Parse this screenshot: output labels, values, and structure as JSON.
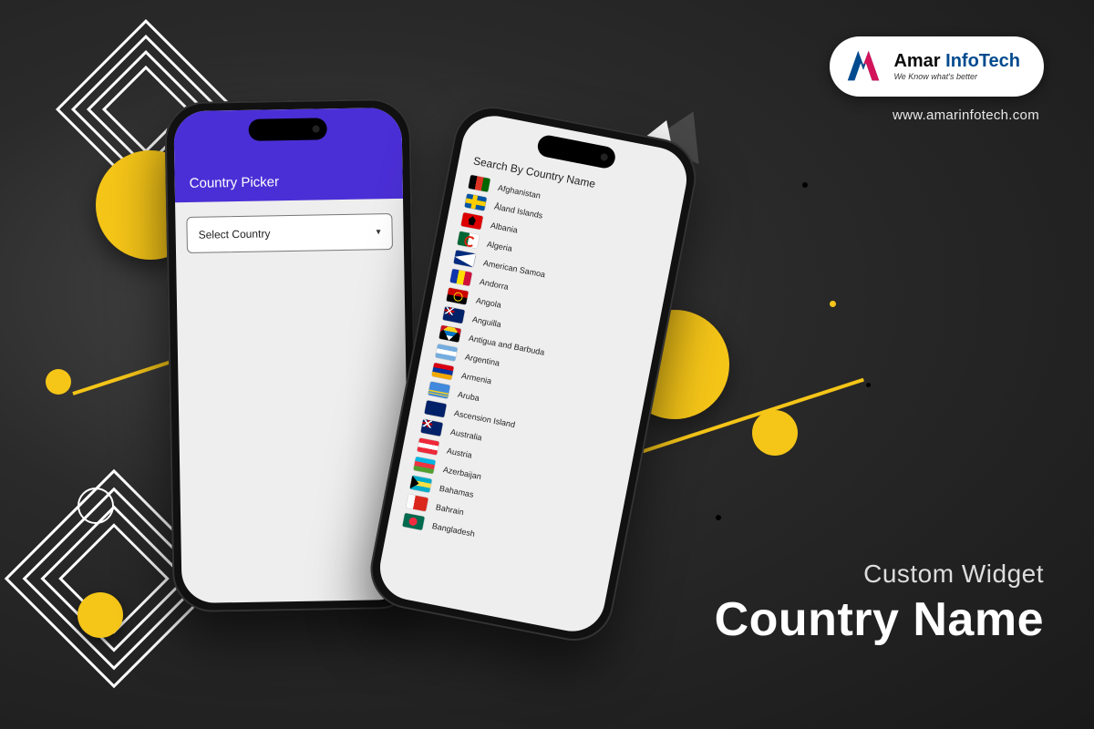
{
  "brand": {
    "name_a": "Amar",
    "name_b": "InfoTech",
    "tagline": "We Know what's better",
    "url": "www.amarinfotech.com"
  },
  "headline": {
    "line1": "Custom Widget",
    "line2": "Country Name"
  },
  "phone_left": {
    "appbar_title": "Country Picker",
    "select_label": "Select Country"
  },
  "phone_right": {
    "search_label": "Search By Country Name",
    "countries": [
      {
        "name": "Afghanistan",
        "flag": "af"
      },
      {
        "name": "Åland Islands",
        "flag": "ax"
      },
      {
        "name": "Albania",
        "flag": "al"
      },
      {
        "name": "Algeria",
        "flag": "dz"
      },
      {
        "name": "American Samoa",
        "flag": "as"
      },
      {
        "name": "Andorra",
        "flag": "ad"
      },
      {
        "name": "Angola",
        "flag": "ao"
      },
      {
        "name": "Anguilla",
        "flag": "ai"
      },
      {
        "name": "Antigua and Barbuda",
        "flag": "ag"
      },
      {
        "name": "Argentina",
        "flag": "ar"
      },
      {
        "name": "Armenia",
        "flag": "am"
      },
      {
        "name": "Aruba",
        "flag": "aw"
      },
      {
        "name": "Ascension Island",
        "flag": "ac"
      },
      {
        "name": "Australia",
        "flag": "au"
      },
      {
        "name": "Austria",
        "flag": "at"
      },
      {
        "name": "Azerbaijan",
        "flag": "az"
      },
      {
        "name": "Bahamas",
        "flag": "bs"
      },
      {
        "name": "Bahrain",
        "flag": "bh"
      },
      {
        "name": "Bangladesh",
        "flag": "bd"
      }
    ]
  }
}
